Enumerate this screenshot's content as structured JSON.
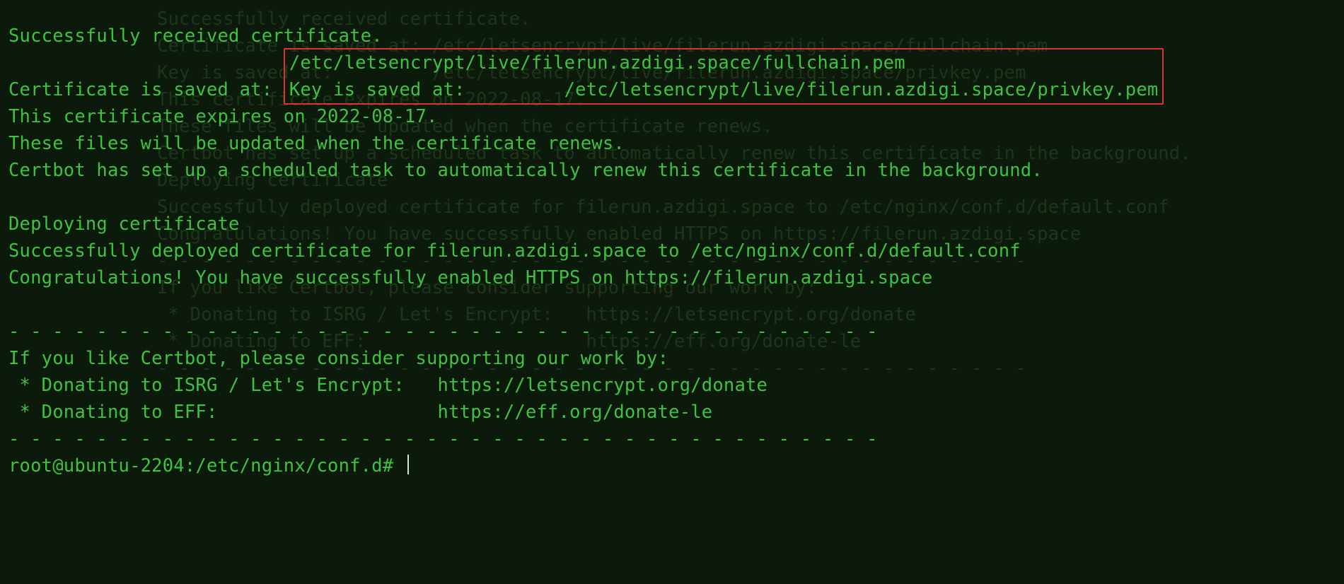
{
  "ghost": {
    "l1": "Successfully received certificate.",
    "l2": "Certificate is saved at: /etc/letsencrypt/live/filerun.azdigi.space/fullchain.pem",
    "l3": "Key is saved at:         /etc/letsencrypt/live/filerun.azdigi.space/privkey.pem",
    "l4": "This certificate expires on 2022-08-17.",
    "l5": "These files will be updated when the certificate renews.",
    "l6": "Certbot has set up a scheduled task to automatically renew this certificate in the background.",
    "l7": "",
    "l8": "Deploying certificate",
    "l9": "Successfully deployed certificate for filerun.azdigi.space to /etc/nginx/conf.d/default.conf",
    "l10": "Congratulations! You have successfully enabled HTTPS on https://filerun.azdigi.space",
    "l11": "",
    "l12": "- - - - - - - - - - - - - - - - - - - - - - - - - - - - - - - - - - - - - - - -",
    "l13": "If you like Certbot, please consider supporting our work by:",
    "l14": " * Donating to ISRG / Let's Encrypt:   https://letsencrypt.org/donate",
    "l15": " * Donating to EFF:                    https://eff.org/donate-le",
    "l16": "- - - - - - - - - - - - - - - - - - - - - - - - - - - - - - - - - - - - - - - -"
  },
  "term": {
    "received": "Successfully received certificate.",
    "cert_label": "Certificate is saved at: ",
    "cert_path": "/etc/letsencrypt/live/filerun.azdigi.space/fullchain.pem",
    "key_label": "Key is saved at:         ",
    "key_path": "/etc/letsencrypt/live/filerun.azdigi.space/privkey.pem",
    "expires": "This certificate expires on 2022-08-17.",
    "updated": "These files will be updated when the certificate renews.",
    "scheduled": "Certbot has set up a scheduled task to automatically renew this certificate in the background.",
    "deploying": "Deploying certificate",
    "deployed": "Successfully deployed certificate for filerun.azdigi.space to /etc/nginx/conf.d/default.conf",
    "congrats": "Congratulations! You have successfully enabled HTTPS on https://filerun.azdigi.space",
    "dashes": "- - - - - - - - - - - - - - - - - - - - - - - - - - - - - - - - - - - - - - - -",
    "support": "If you like Certbot, please consider supporting our work by:",
    "donate_isrg": " * Donating to ISRG / Let's Encrypt:   https://letsencrypt.org/donate",
    "donate_eff": " * Donating to EFF:                    https://eff.org/donate-le",
    "prompt": "root@ubuntu-2204:/etc/nginx/conf.d# "
  }
}
